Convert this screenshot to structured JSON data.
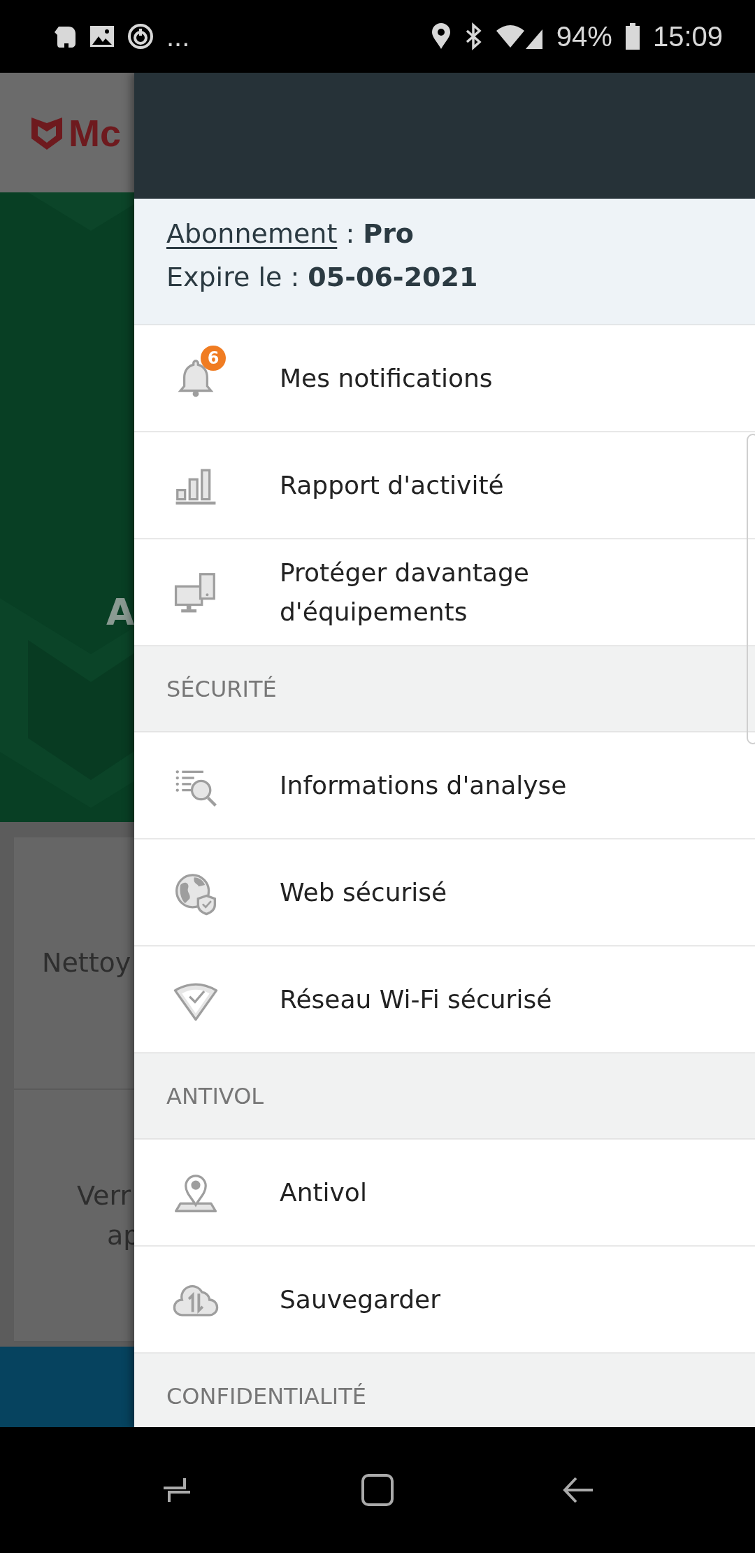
{
  "status_bar": {
    "overflow": "...",
    "battery": "94%",
    "time": "15:09"
  },
  "background_app": {
    "logo_text": "Mc",
    "hero_title": "A",
    "cards": [
      {
        "lines": [
          "Nettoy"
        ]
      },
      {
        "lines": [
          "Verr",
          "ap"
        ]
      }
    ]
  },
  "drawer": {
    "subscription": {
      "link": "Abonnement",
      "plan": ": **Pro**",
      "expiry": "Expire le : **05-06-2021**"
    },
    "items": [
      {
        "kind": "item",
        "label": "Mes notifications",
        "badge": "6"
      },
      {
        "kind": "item",
        "label": "Rapport d'activité"
      },
      {
        "kind": "item",
        "label": "Protéger davantage d'équipements"
      },
      {
        "kind": "section",
        "label": "SÉCURITÉ"
      },
      {
        "kind": "item",
        "label": "Informations d'analyse"
      },
      {
        "kind": "item",
        "label": "Web sécurisé"
      },
      {
        "kind": "item",
        "label": "Réseau Wi-Fi sécurisé"
      },
      {
        "kind": "section",
        "label": "ANTIVOL"
      },
      {
        "kind": "item",
        "label": "Antivol"
      },
      {
        "kind": "item",
        "label": "Sauvegarder"
      },
      {
        "kind": "section",
        "label": "CONFIDENTIALITÉ"
      }
    ]
  }
}
